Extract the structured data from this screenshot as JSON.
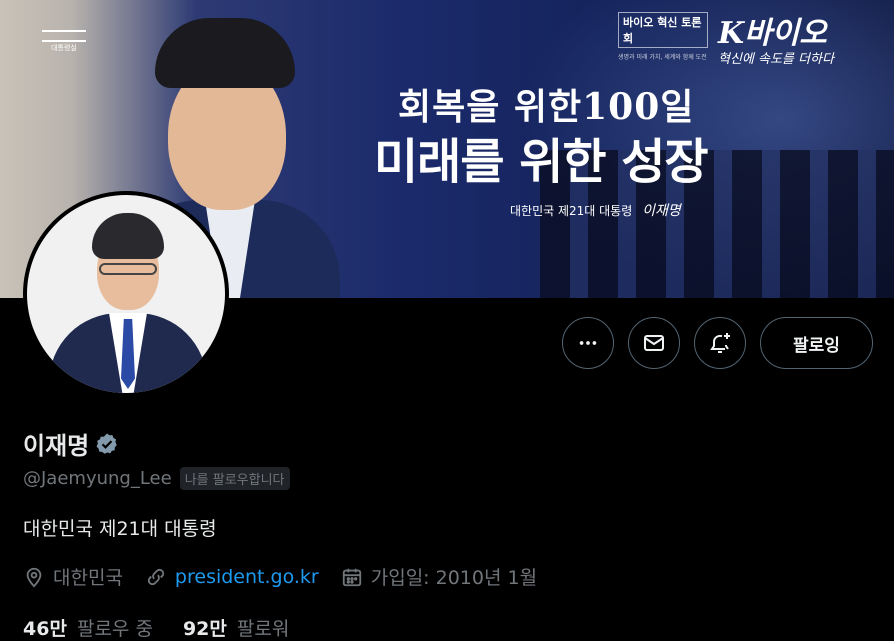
{
  "banner": {
    "logo_text": "대통령실",
    "headline1": "회복을 위한100일",
    "headline2": "미래를 위한 성장",
    "subline": "대한민국 제21대 대통령",
    "signature": "이재명",
    "forum_title": "바이오 혁신 토론회",
    "forum_desc": "생명과 미래 가치, 세계와 함께 도전",
    "kbio_title": "K바이오",
    "kbio_sub": "혁신에 속도를 더하다"
  },
  "profile": {
    "name": "이재명",
    "handle": "@Jaemyung_Lee",
    "follows_you": "나를 팔로우합니다",
    "bio": "대한민국 제21대 대통령",
    "location": "대한민국",
    "website": "president.go.kr",
    "joined": "가입일: 2010년 1월",
    "following_count": "46만",
    "following_label": "팔로우 중",
    "followers_count": "92만",
    "followers_label": "팔로워"
  },
  "actions": {
    "follow_label": "팔로잉"
  },
  "icons": {
    "more": "more-icon",
    "message": "mail-icon",
    "notify": "bell-plus-icon",
    "verified": "verified-badge-icon",
    "location": "location-pin-icon",
    "link": "link-icon",
    "calendar": "calendar-icon"
  },
  "colors": {
    "background": "#000000",
    "text_primary": "#e7e9ea",
    "text_secondary": "#71767b",
    "link": "#1d9bf0",
    "verified_badge": "#829aab",
    "button_border": "#536471"
  }
}
